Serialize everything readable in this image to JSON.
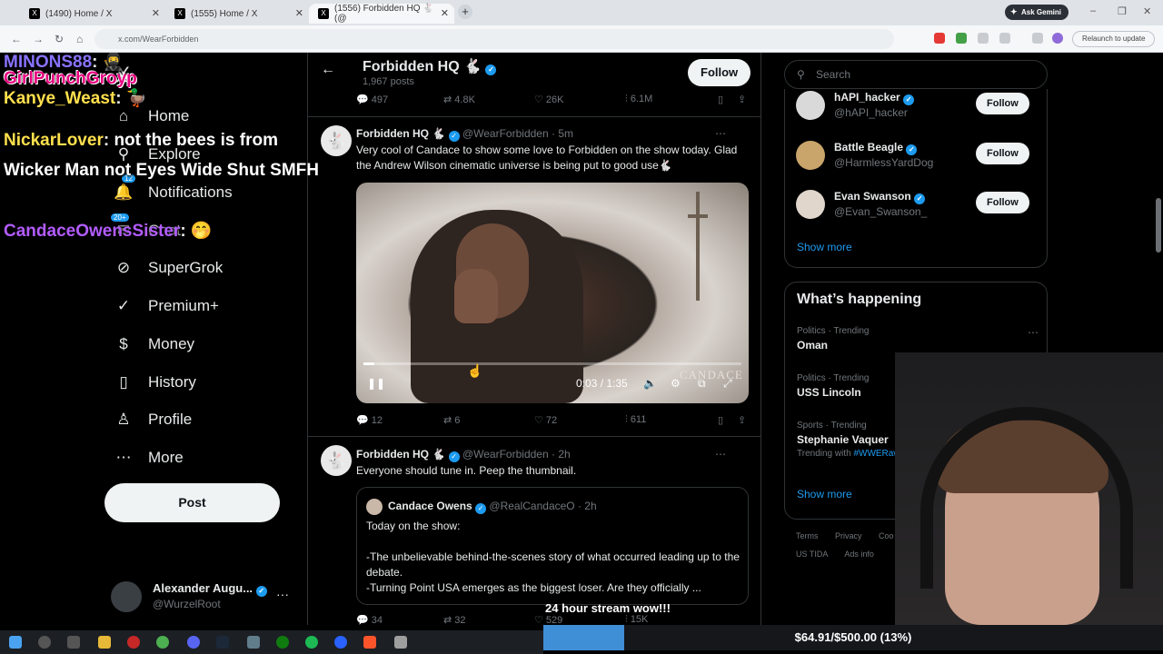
{
  "browser": {
    "tabs": [
      {
        "title": "(1490) Home / X",
        "active": false
      },
      {
        "title": "(1555) Home / X",
        "active": false
      },
      {
        "title": "(1556) Forbidden HQ 🐇 (@",
        "active": true
      }
    ],
    "new_tab": "+",
    "ask_gemini": "Ask Gemini",
    "url": "x.com/WearForbidden",
    "relaunch": "Relaunch to update"
  },
  "stream": {
    "banner": "GirlPunchGroyp",
    "chat": [
      {
        "user": "MINONS88",
        "text": "🥷",
        "user_color": "#8a73ff"
      },
      {
        "user": "Kanye_Weast",
        "text": "🦆",
        "user_color": "#ffe04d"
      },
      {
        "user": "NickarLover",
        "text": "not the bees is from Wicker Man not Eyes Wide Shut SMFH",
        "user_color": "#ffe04d"
      },
      {
        "user": "CandaceOwensSister",
        "text": "🤭",
        "user_color": "#b35cff"
      }
    ],
    "message": "24 hour stream wow!!!",
    "goal": {
      "text": "$64.91/$500.00 (13%)",
      "fraction": 0.13
    }
  },
  "nav": {
    "logo": "𝕏",
    "items": [
      {
        "label": "Home",
        "icon": "home-icon",
        "glyph": "⌂"
      },
      {
        "label": "Explore",
        "icon": "search-icon",
        "glyph": "⚲"
      },
      {
        "label": "Notifications",
        "icon": "bell-icon",
        "glyph": "🔔",
        "badge": "12"
      },
      {
        "label": "Chat",
        "icon": "chat-icon",
        "glyph": "✉",
        "badge": "20+"
      },
      {
        "label": "SuperGrok",
        "icon": "grok-icon",
        "glyph": "⊘"
      },
      {
        "label": "Premium+",
        "icon": "premium-icon",
        "glyph": "✓"
      },
      {
        "label": "Money",
        "icon": "money-icon",
        "glyph": "$"
      },
      {
        "label": "History",
        "icon": "bookmark-icon",
        "glyph": "▯"
      },
      {
        "label": "Profile",
        "icon": "person-icon",
        "glyph": "♙"
      },
      {
        "label": "More",
        "icon": "more-icon",
        "glyph": "⋯"
      }
    ],
    "post": "Post",
    "account": {
      "name": "Alexander Augu...",
      "handle": "@WurzelRoot",
      "more": "···"
    }
  },
  "profile": {
    "back": "←",
    "name": "Forbidden HQ 🐇",
    "posts": "1,967 posts",
    "follow": "Follow"
  },
  "top_actions": {
    "replies": "497",
    "reposts": "4.8K",
    "likes": "26K",
    "views": "6.1M"
  },
  "tweet1": {
    "name": "Forbidden HQ 🐇",
    "handle": "@WearForbidden",
    "time": "· 5m",
    "text": "Very cool of Candace to show some love to Forbidden on the show today. Glad the Andrew Wilson cinematic universe is being put to good use🐇",
    "video": {
      "time": "0:03 / 1:35",
      "watermark": "CANDACE",
      "progress": 0.03
    },
    "actions": {
      "replies": "12",
      "reposts": "6",
      "likes": "72",
      "views": "611"
    }
  },
  "tweet2": {
    "name": "Forbidden HQ 🐇",
    "handle": "@WearForbidden",
    "time": "· 2h",
    "text": "Everyone should tune in. Peep the thumbnail.",
    "quote": {
      "name": "Candace Owens",
      "handle": "@RealCandaceO · 2h",
      "text": "Today on the show:\n\n-The unbelievable behind-the-scenes story of what occurred leading up to the debate.\n-Turning Point USA emerges as the biggest loser. Are they officially ..."
    },
    "actions": {
      "replies": "34",
      "reposts": "32",
      "likes": "529",
      "views": "15K"
    }
  },
  "sidebar": {
    "search_placeholder": "Search",
    "who_to_follow": [
      {
        "name": "hAPI_hacker",
        "handle": "@hAPI_hacker",
        "follow": "Follow"
      },
      {
        "name": "Battle Beagle",
        "handle": "@HarmlessYardDog",
        "follow": "Follow"
      },
      {
        "name": "Evan Swanson",
        "handle": "@Evan_Swanson_",
        "follow": "Follow"
      }
    ],
    "show_more": "Show more",
    "happening_title": "What’s happening",
    "trends": [
      {
        "meta": "Politics · Trending",
        "title": "Oman",
        "with": ""
      },
      {
        "meta": "Politics · Trending",
        "title": "USS Lincoln",
        "with": ""
      },
      {
        "meta": "Sports · Trending",
        "title": "Stephanie Vaquer",
        "with_label": "Trending with",
        "with": "#WWERaw"
      }
    ],
    "show_more_2": "Show more",
    "footer": [
      "Terms",
      "Privacy",
      "Coo",
      "US TIDA",
      "Ads info"
    ]
  },
  "colors": {
    "accent": "#1d9bf0",
    "verified": "#1d9bf0",
    "goal_fill": "#3f8fd6"
  }
}
